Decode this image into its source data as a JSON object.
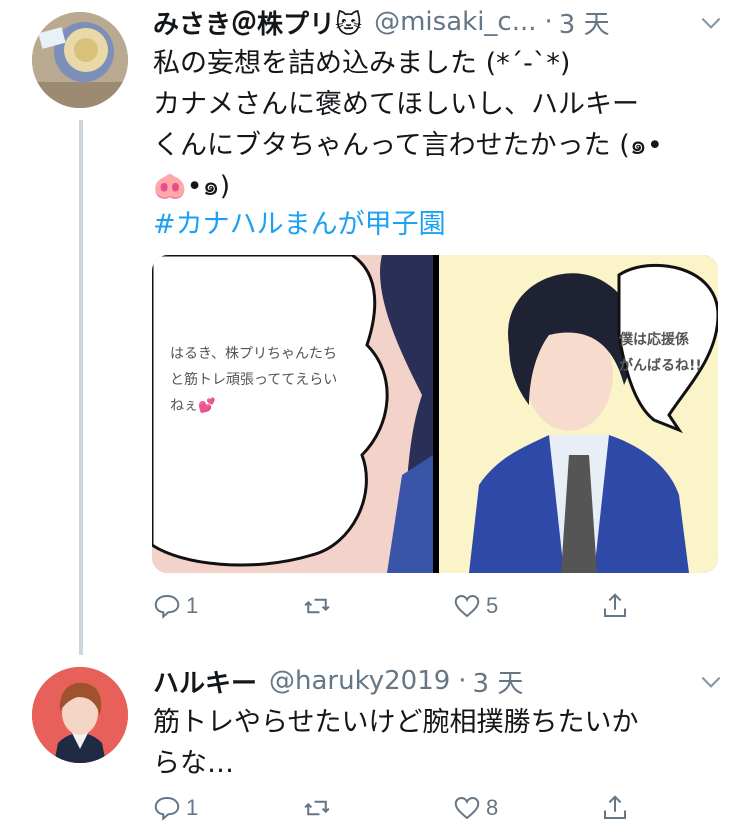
{
  "tweets": [
    {
      "name": "みさき＠株プリ🐱",
      "handle": "@misaki_c...",
      "time": "3 天",
      "text": "私の妄想を詰め込みました (*´-`*)\nカナメさんに褒めてほしいし、ハルキー\nくんにブタちゃんって言わせたかった (๑•\n🐽•๑)",
      "hashtag": "#カナハルまんが甲子園",
      "media": {
        "left_bubble": "はるき、株プリちゃんたち\nと筋トレ頑張っててえらい\nねぇ💕",
        "right_bubble": "僕は応援係\nがんばるね!!"
      },
      "actions": {
        "replies": "1",
        "retweets": "",
        "likes": "5"
      }
    },
    {
      "name": "ハルキー",
      "handle": "@haruky2019",
      "time": "3 天",
      "text": "筋トレやらせたいけど腕相撲勝ちたいか\nらな…",
      "actions": {
        "replies": "1",
        "retweets": "",
        "likes": "8"
      }
    }
  ],
  "icons": {
    "reply": "reply-icon",
    "retweet": "retweet-icon",
    "like": "heart-icon",
    "share": "share-icon",
    "more": "chevron-down-icon"
  },
  "colors": {
    "link": "#1da1f2",
    "muted": "#657786",
    "thread": "#ccd6dd"
  }
}
